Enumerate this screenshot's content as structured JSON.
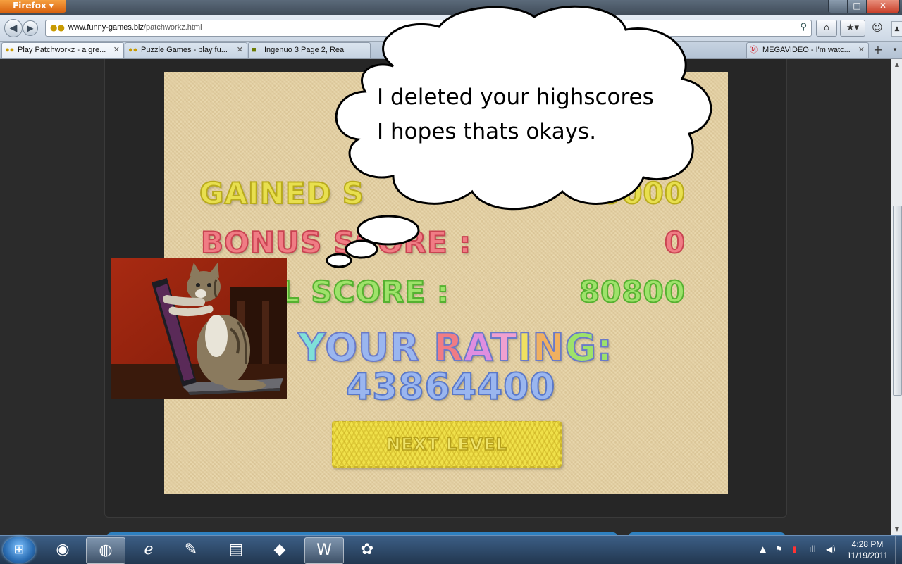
{
  "browser": {
    "menu_label": "Firefox ▾",
    "window_controls": {
      "minimize": "–",
      "maximize": "□",
      "close": "✕"
    },
    "url": {
      "domain": "www.funny-games.biz",
      "path": "/patchworkz.html"
    },
    "tabs": [
      {
        "label": "Play Patchworkz - a gre...",
        "active": true
      },
      {
        "label": "Puzzle Games - play fu...",
        "active": false
      },
      {
        "label": "Ingenuo 3 Page 2, Rea",
        "active": false
      },
      {
        "label": "MEGAVIDEO - I'm watc...",
        "active": false
      }
    ]
  },
  "game": {
    "gained_label": "GAINED S",
    "gained_value": "0000",
    "bonus_label": "BONUS SCORE :",
    "bonus_value": "0",
    "total_label": "L SCORE :",
    "total_value": "80800",
    "rating_label": "YOUR RATING:",
    "rating_value": "43864400",
    "next_level_label": "NEXT LEVEL"
  },
  "meme": {
    "line1": "I deleted your highscores",
    "line2": "I hopes thats okays."
  },
  "taskbar": {
    "time": "4:28 PM",
    "date": "11/19/2011"
  }
}
